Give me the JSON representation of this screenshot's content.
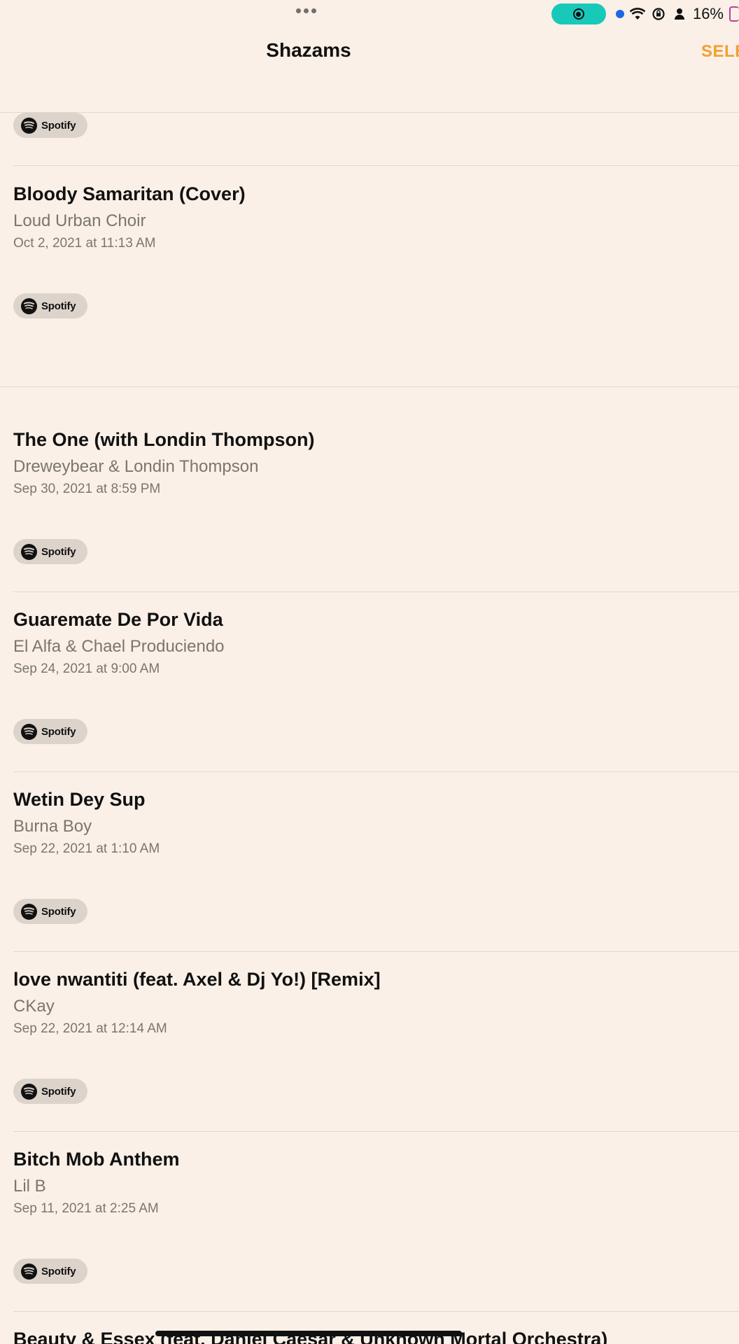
{
  "status_bar": {
    "battery_percent": "16%"
  },
  "nav": {
    "title": "Shazams",
    "select_label": "SELE"
  },
  "partial_top_item": {
    "spotify_label": "Spotify"
  },
  "songs": [
    {
      "title": "Bloody Samaritan (Cover)",
      "artist": "Loud Urban Choir",
      "date": "Oct 2, 2021 at 11:13 AM",
      "spotify_label": "Spotify"
    },
    {
      "title": "The One (with Londin Thompson)",
      "artist": "Dreweybear & Londin Thompson",
      "date": "Sep 30, 2021 at 8:59 PM",
      "spotify_label": "Spotify"
    },
    {
      "title": "Guaremate De Por Vida",
      "artist": "El Alfa & Chael Produciendo",
      "date": "Sep 24, 2021 at 9:00 AM",
      "spotify_label": "Spotify"
    },
    {
      "title": "Wetin Dey Sup",
      "artist": "Burna Boy",
      "date": "Sep 22, 2021 at 1:10 AM",
      "spotify_label": "Spotify"
    },
    {
      "title": "love nwantiti (feat. Axel & Dj Yo!) [Remix]",
      "artist": "CKay",
      "date": "Sep 22, 2021 at 12:14 AM",
      "spotify_label": "Spotify"
    },
    {
      "title": "Bitch Mob Anthem",
      "artist": "Lil B",
      "date": "Sep 11, 2021 at 2:25 AM",
      "spotify_label": "Spotify"
    },
    {
      "title": "Beauty & Essex (feat. Daniel Caesar & Unknown Mortal Orchestra)"
    }
  ],
  "colors": {
    "background": "#faf0e7",
    "accent": "#f0a030",
    "record_pill": "#18c9ba"
  }
}
